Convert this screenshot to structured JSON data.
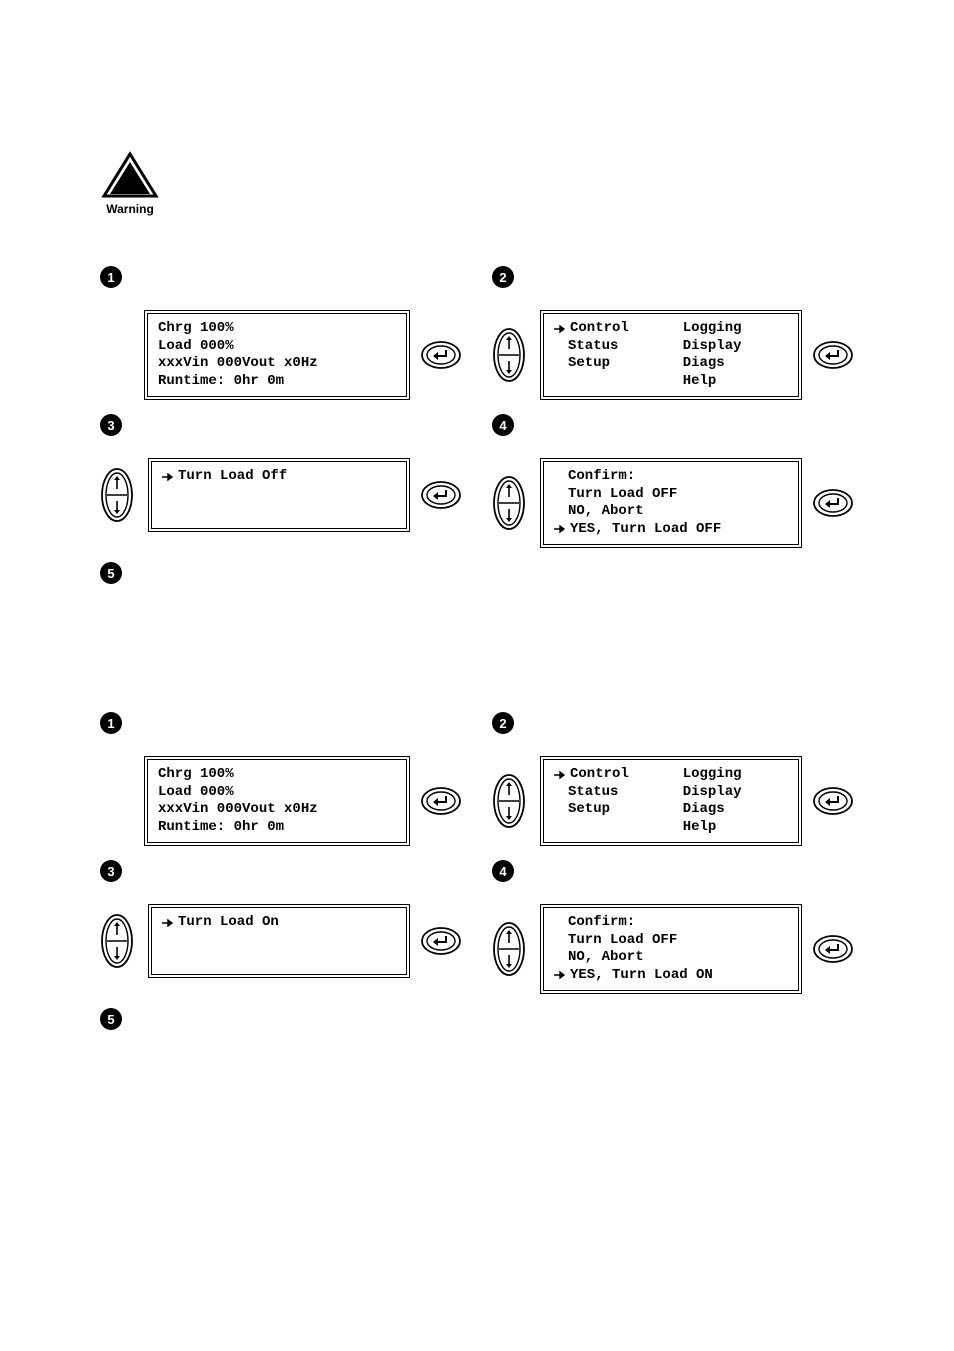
{
  "warning": {
    "label": "Warning"
  },
  "stepNums": {
    "1": "1",
    "2": "2",
    "3": "3",
    "4": "4",
    "5": "5"
  },
  "sec1": {
    "step1_lcd": {
      "l1": "Chrg 100%",
      "l2": "Load 000%",
      "l3": "xxxVin 000Vout x0Hz",
      "l4": "Runtime: 0hr 0m"
    },
    "step2_menu": {
      "left": {
        "l1": "Control",
        "l2": "Status",
        "l3": "Setup"
      },
      "right": {
        "l1": "Logging",
        "l2": "Display",
        "l3": "Diags",
        "l4": "Help"
      }
    },
    "step3_lcd": {
      "l1": "Turn Load Off"
    },
    "step4_confirm": {
      "l1": "Confirm:",
      "l2": "Turn Load OFF",
      "l3": "NO, Abort",
      "l4": "YES, Turn Load OFF"
    }
  },
  "sec2": {
    "step1_lcd": {
      "l1": "Chrg 100%",
      "l2": "Load 000%",
      "l3": "xxxVin 000Vout x0Hz",
      "l4": "Runtime: 0hr 0m"
    },
    "step2_menu": {
      "left": {
        "l1": "Control",
        "l2": "Status",
        "l3": "Setup"
      },
      "right": {
        "l1": "Logging",
        "l2": "Display",
        "l3": "Diags",
        "l4": "Help"
      }
    },
    "step3_lcd": {
      "l1": "Turn Load On"
    },
    "step4_confirm": {
      "l1": "Confirm:",
      "l2": "Turn Load OFF",
      "l3": "NO, Abort",
      "l4": "YES, Turn Load ON"
    }
  }
}
